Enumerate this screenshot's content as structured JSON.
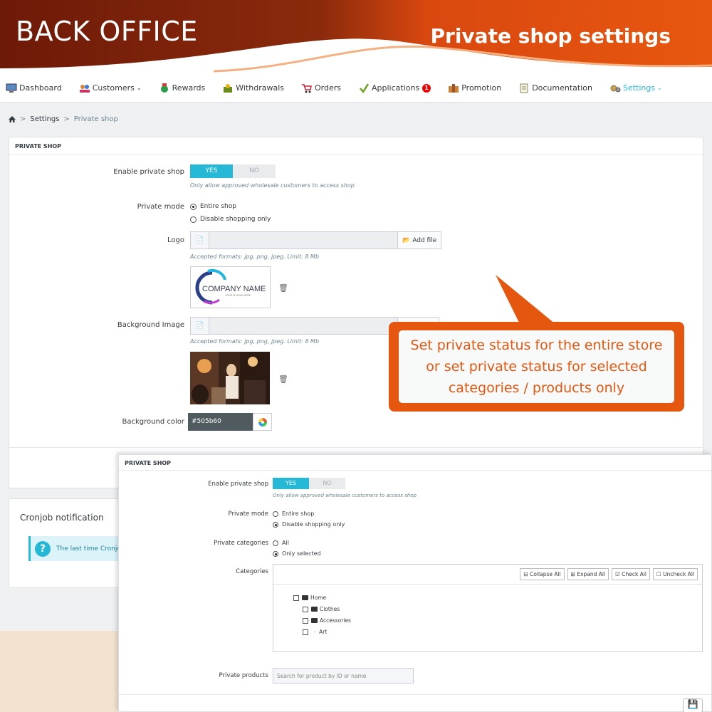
{
  "banner": {
    "left_title": "BACK OFFICE",
    "right_title": "Private shop settings",
    "colors": {
      "dark": "#7a1e0a",
      "orange": "#e5560f"
    }
  },
  "nav": {
    "items": [
      {
        "label": "Dashboard",
        "icon": "dashboard-icon"
      },
      {
        "label": "Customers",
        "icon": "customers-icon",
        "chevron": true
      },
      {
        "label": "Rewards",
        "icon": "rewards-icon"
      },
      {
        "label": "Withdrawals",
        "icon": "withdrawals-icon"
      },
      {
        "label": "Orders",
        "icon": "orders-icon"
      },
      {
        "label": "Applications",
        "icon": "applications-icon",
        "badge": "1"
      },
      {
        "label": "Promotion",
        "icon": "promotion-icon"
      },
      {
        "label": "Documentation",
        "icon": "documentation-icon"
      },
      {
        "label": "Settings",
        "icon": "settings-icon",
        "chevron": true,
        "active": true
      }
    ]
  },
  "breadcrumb": {
    "sep": ">",
    "settings": "Settings",
    "current": "Private shop"
  },
  "panel1": {
    "title": "PRIVATE SHOP",
    "enable_label": "Enable private shop",
    "yes": "YES",
    "no": "NO",
    "enable_help": "Only allow approved wholesale customers to access shop",
    "mode_label": "Private mode",
    "mode_entire": "Entire shop",
    "mode_disable": "Disable shopping only",
    "logo_label": "Logo",
    "add_file": "Add file",
    "formats_help": "Accepted formats: jpg, png, jpeg. Limit: 8 Mb",
    "logo_text": "COMPANY NAME",
    "logo_slogan": "YOUR SLOGAN HERE",
    "bg_image_label": "Background Image",
    "bg_color_label": "Background color",
    "bg_color_value": "#505b60"
  },
  "cron": {
    "title": "Cronjob notification",
    "text": "The last time Cronjob"
  },
  "callout": {
    "text": "Set private status for the entire store or set private status for selected categories / products only"
  },
  "panel2": {
    "title": "PRIVATE SHOP",
    "enable_label": "Enable private shop",
    "yes": "YES",
    "no": "NO",
    "enable_help": "Only allow approved wholesale customers to access shop",
    "mode_label": "Private mode",
    "mode_entire": "Entire shop",
    "mode_disable": "Disable shopping only",
    "cats_label": "Private categories",
    "cats_all": "All",
    "cats_selected": "Only selected",
    "categories_label": "Categories",
    "collapse_all": "Collapse All",
    "expand_all": "Expand All",
    "check_all": "Check All",
    "uncheck_all": "Uncheck All",
    "tree": [
      "Home",
      "Clothes",
      "Accessories",
      "Art"
    ],
    "products_label": "Private products",
    "products_placeholder": "Search for product by ID or name"
  }
}
